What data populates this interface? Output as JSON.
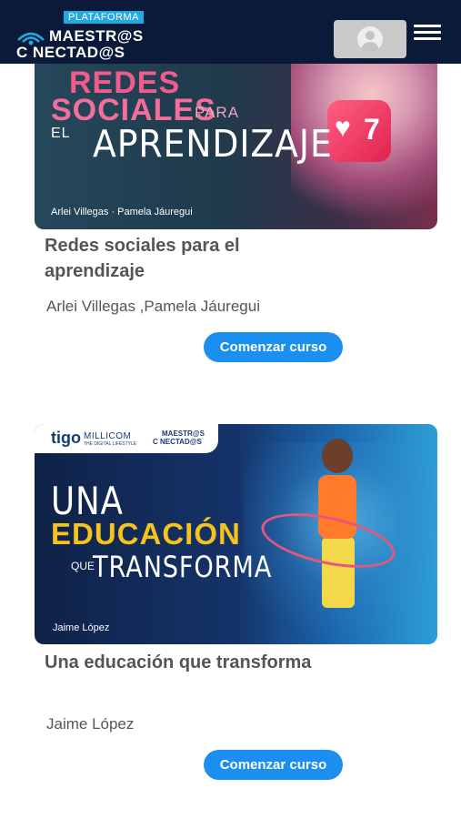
{
  "header": {
    "logo": {
      "tag": "PLATAFORMA",
      "line1": "MAESTR@S",
      "line2": "C   NECTAD@S"
    },
    "profile_icon": "user-avatar-icon",
    "menu_icon": "hamburger-menu-icon"
  },
  "courses": [
    {
      "banner": {
        "line1": "REDES",
        "line2": "SOCIALES",
        "line2_suffix": "PARA",
        "line3_prefix": "EL",
        "line3": "APRENDIZAJE",
        "authors": "Arlei Villegas · Pamela Jáuregui",
        "like_count": "7"
      },
      "title": "Redes sociales para el aprendizaje",
      "authors": "Arlei Villegas  ,Pamela Jáuregui",
      "button_label": "Comenzar curso"
    },
    {
      "banner": {
        "brand1": "tigo",
        "brand2": "MILLICOM",
        "brand2_sub": "THE DIGITAL LIFESTYLE",
        "brand3_line1": "MAESTR@S",
        "brand3_line2": "C NECTAD@S",
        "line1": "UNA",
        "line2": "EDUCACIÓN",
        "line3_prefix": "QUE",
        "line3": "TRANSFORMA",
        "authors": "Jaime López"
      },
      "title": "Una educación que transforma",
      "authors": "Jaime López",
      "button_label": "Comenzar curso"
    }
  ],
  "colors": {
    "header_bg": "#0c1a3a",
    "button_bg": "#1a8ff0",
    "title_text": "#555555",
    "accent_pink": "#f25b8c",
    "accent_yellow": "#f6c21c"
  }
}
